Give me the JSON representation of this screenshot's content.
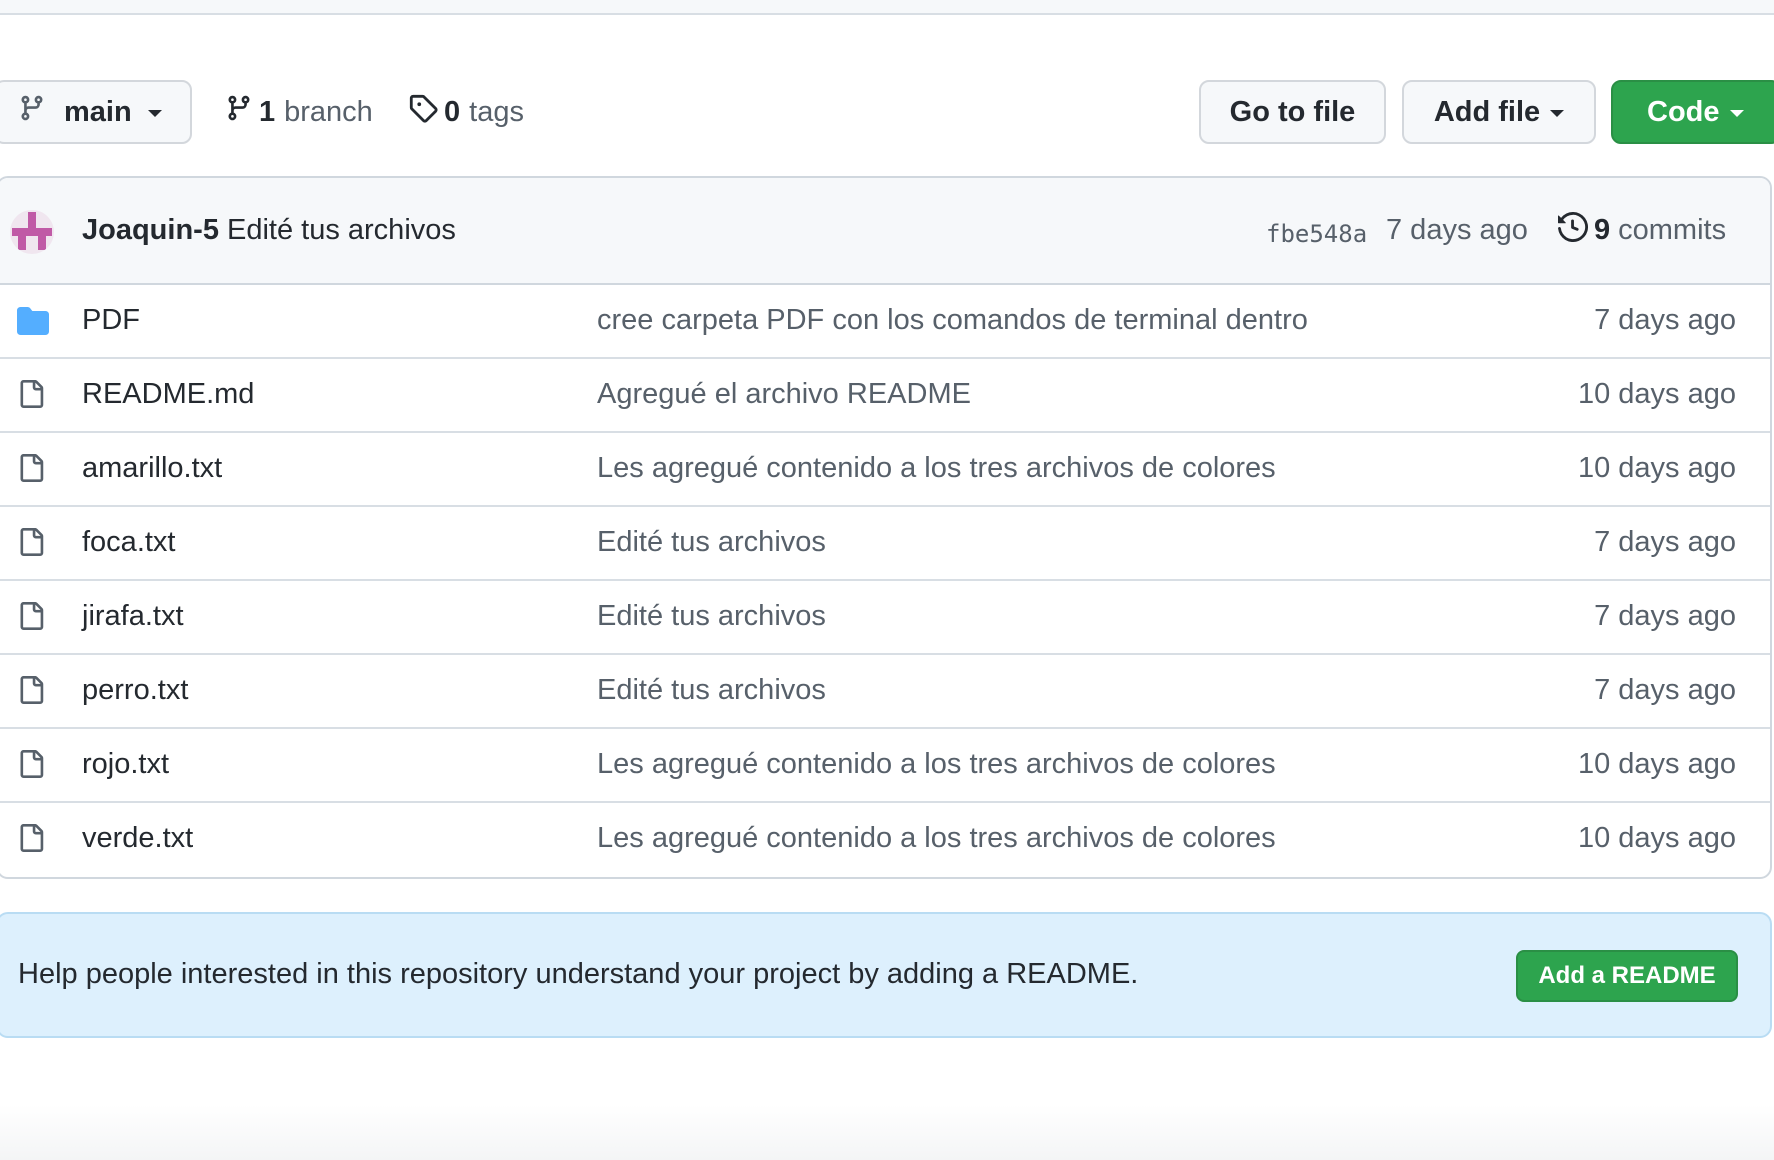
{
  "toolbar": {
    "branch_name": "main",
    "branch_count": "1",
    "branch_label": "branch",
    "tag_count": "0",
    "tag_label": "tags",
    "go_to_file": "Go to file",
    "add_file": "Add file",
    "code": "Code"
  },
  "latest_commit": {
    "author": "Joaquin-5",
    "message": "Edité tus archivos",
    "sha": "fbe548a",
    "time": "7 days ago",
    "commit_count": "9",
    "commit_label": "commits"
  },
  "files": [
    {
      "type": "folder",
      "name": "PDF",
      "message": "cree carpeta PDF con los comandos de terminal dentro",
      "time": "7 days ago"
    },
    {
      "type": "file",
      "name": "README.md",
      "message": "Agregué el archivo README",
      "time": "10 days ago"
    },
    {
      "type": "file",
      "name": "amarillo.txt",
      "message": "Les agregué contenido a los tres archivos de colores",
      "time": "10 days ago"
    },
    {
      "type": "file",
      "name": "foca.txt",
      "message": "Edité tus archivos",
      "time": "7 days ago"
    },
    {
      "type": "file",
      "name": "jirafa.txt",
      "message": "Edité tus archivos",
      "time": "7 days ago"
    },
    {
      "type": "file",
      "name": "perro.txt",
      "message": "Edité tus archivos",
      "time": "7 days ago"
    },
    {
      "type": "file",
      "name": "rojo.txt",
      "message": "Les agregué contenido a los tres archivos de colores",
      "time": "10 days ago"
    },
    {
      "type": "file",
      "name": "verde.txt",
      "message": "Les agregué contenido a los tres archivos de colores",
      "time": "10 days ago"
    }
  ],
  "readme_banner": {
    "text": "Help people interested in this repository understand your project by adding a README.",
    "button": "Add a README"
  },
  "colors": {
    "primary_button": "#2da44e",
    "folder_icon": "#54aeff",
    "banner_background": "#ddf0fd"
  }
}
